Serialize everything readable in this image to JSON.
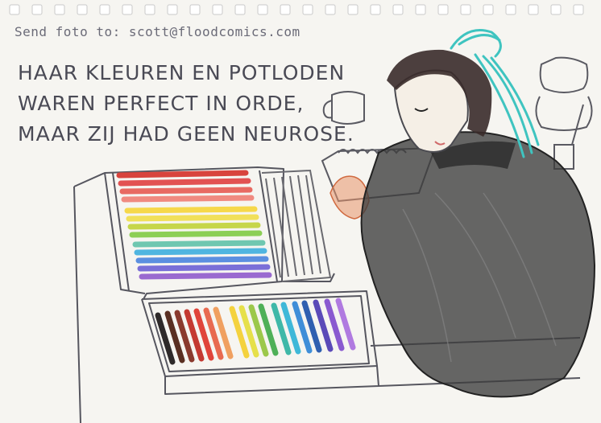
{
  "header_note": "Send foto to: scott@floodcomics.com",
  "caption": {
    "line1": "HAAR KLEUREN EN POTLODEN",
    "line2": "WAREN PERFECT IN ORDE,",
    "line3": "MAAR ZIJ HAD GEEN NEUROSE."
  },
  "colors": {
    "paper": "#f6f5f1",
    "pencil_line": "#55555f",
    "hair_accent": "#3fc4c0",
    "sweater": "#3a3a3a"
  }
}
